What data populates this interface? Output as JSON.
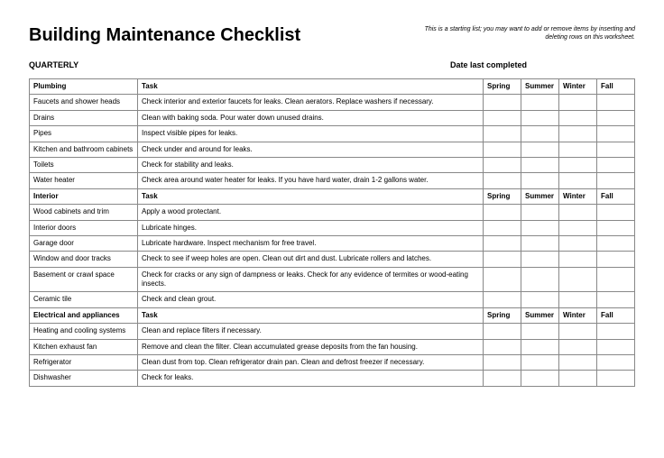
{
  "title": "Building Maintenance Checklist",
  "note": "This is a starting list; you may want to add or remove items by inserting and deleting rows on this worksheet.",
  "quarterly": "QUARTERLY",
  "dateLabel": "Date last completed",
  "seasonHeaders": [
    "Spring",
    "Summer",
    "Winter",
    "Fall"
  ],
  "taskHeader": "Task",
  "sections": [
    {
      "name": "Plumbing",
      "rows": [
        {
          "item": "Faucets and shower heads",
          "task": "Check interior and exterior faucets for leaks. Clean aerators. Replace washers if necessary."
        },
        {
          "item": "Drains",
          "task": "Clean with baking soda. Pour water down unused drains."
        },
        {
          "item": "Pipes",
          "task": "Inspect visible pipes for leaks."
        },
        {
          "item": "Kitchen and bathroom cabinets",
          "task": "Check under and around for leaks."
        },
        {
          "item": "Toilets",
          "task": "Check for stability and leaks."
        },
        {
          "item": "Water heater",
          "task": "Check area around water heater for leaks. If you have hard water, drain 1-2 gallons water."
        }
      ]
    },
    {
      "name": "Interior",
      "rows": [
        {
          "item": "Wood cabinets and trim",
          "task": "Apply a wood protectant."
        },
        {
          "item": "Interior doors",
          "task": "Lubricate hinges."
        },
        {
          "item": "Garage door",
          "task": "Lubricate hardware. Inspect mechanism for free travel."
        },
        {
          "item": "Window and door tracks",
          "task": "Check to see if weep holes are open. Clean out dirt and dust. Lubricate rollers and latches."
        },
        {
          "item": "Basement or crawl space",
          "task": "Check for cracks or any sign of dampness or leaks. Check for any evidence of termites or wood-eating insects."
        },
        {
          "item": "Ceramic tile",
          "task": "Check and clean grout."
        }
      ]
    },
    {
      "name": "Electrical and appliances",
      "rows": [
        {
          "item": "Heating and cooling systems",
          "task": "Clean and replace filters if necessary."
        },
        {
          "item": "Kitchen exhaust fan",
          "task": "Remove and clean the filter. Clean accumulated grease deposits from the fan housing."
        },
        {
          "item": "Refrigerator",
          "task": "Clean dust from top. Clean refrigerator drain pan. Clean and defrost freezer if necessary."
        },
        {
          "item": "Dishwasher",
          "task": "Check for leaks."
        }
      ]
    }
  ]
}
